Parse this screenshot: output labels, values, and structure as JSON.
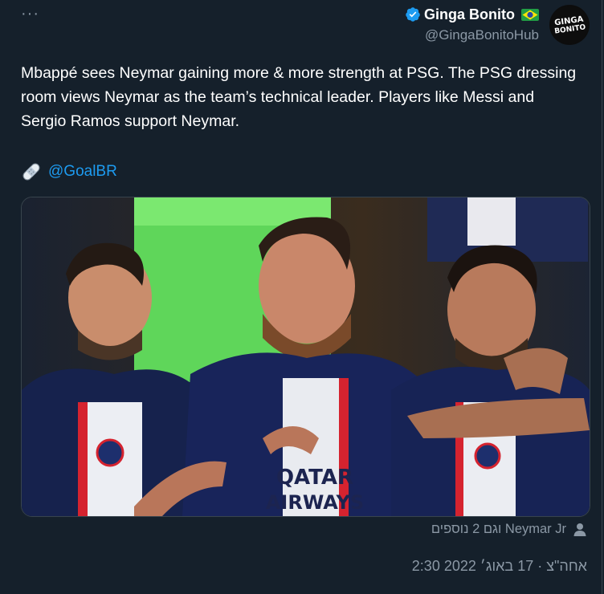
{
  "tweet": {
    "more_label": "···",
    "author_name": "Ginga Bonito",
    "author_handle": "@GingaBonitoHub",
    "avatar_text_line1": "GINGA",
    "avatar_text_line2": "BONITO",
    "text": "Mbappé sees Neymar gaining more & more strength at PSG. The PSG dressing room views Neymar as the team’s technical leader. Players like Messi and Sergio Ramos support Neymar.",
    "source_mention": "@GoalBR",
    "tagged_people": "וגם 2 נוספים Neymar Jr",
    "timestamp": "אחה\"צ · 17 באוג׳ 2022 2:30"
  },
  "photo": {
    "jersey_sponsor_line1": "QATAR",
    "jersey_sponsor_line2": "AIRWAYS"
  },
  "colors": {
    "background": "#15202b",
    "secondary_text": "#8b98a5",
    "link": "#1d9bf0",
    "verified": "#1d9bf0",
    "border": "#38444d"
  },
  "icons": [
    "more-icon",
    "verified-badge-icon",
    "brazil-flag-icon",
    "bandage-icon",
    "person-icon"
  ]
}
